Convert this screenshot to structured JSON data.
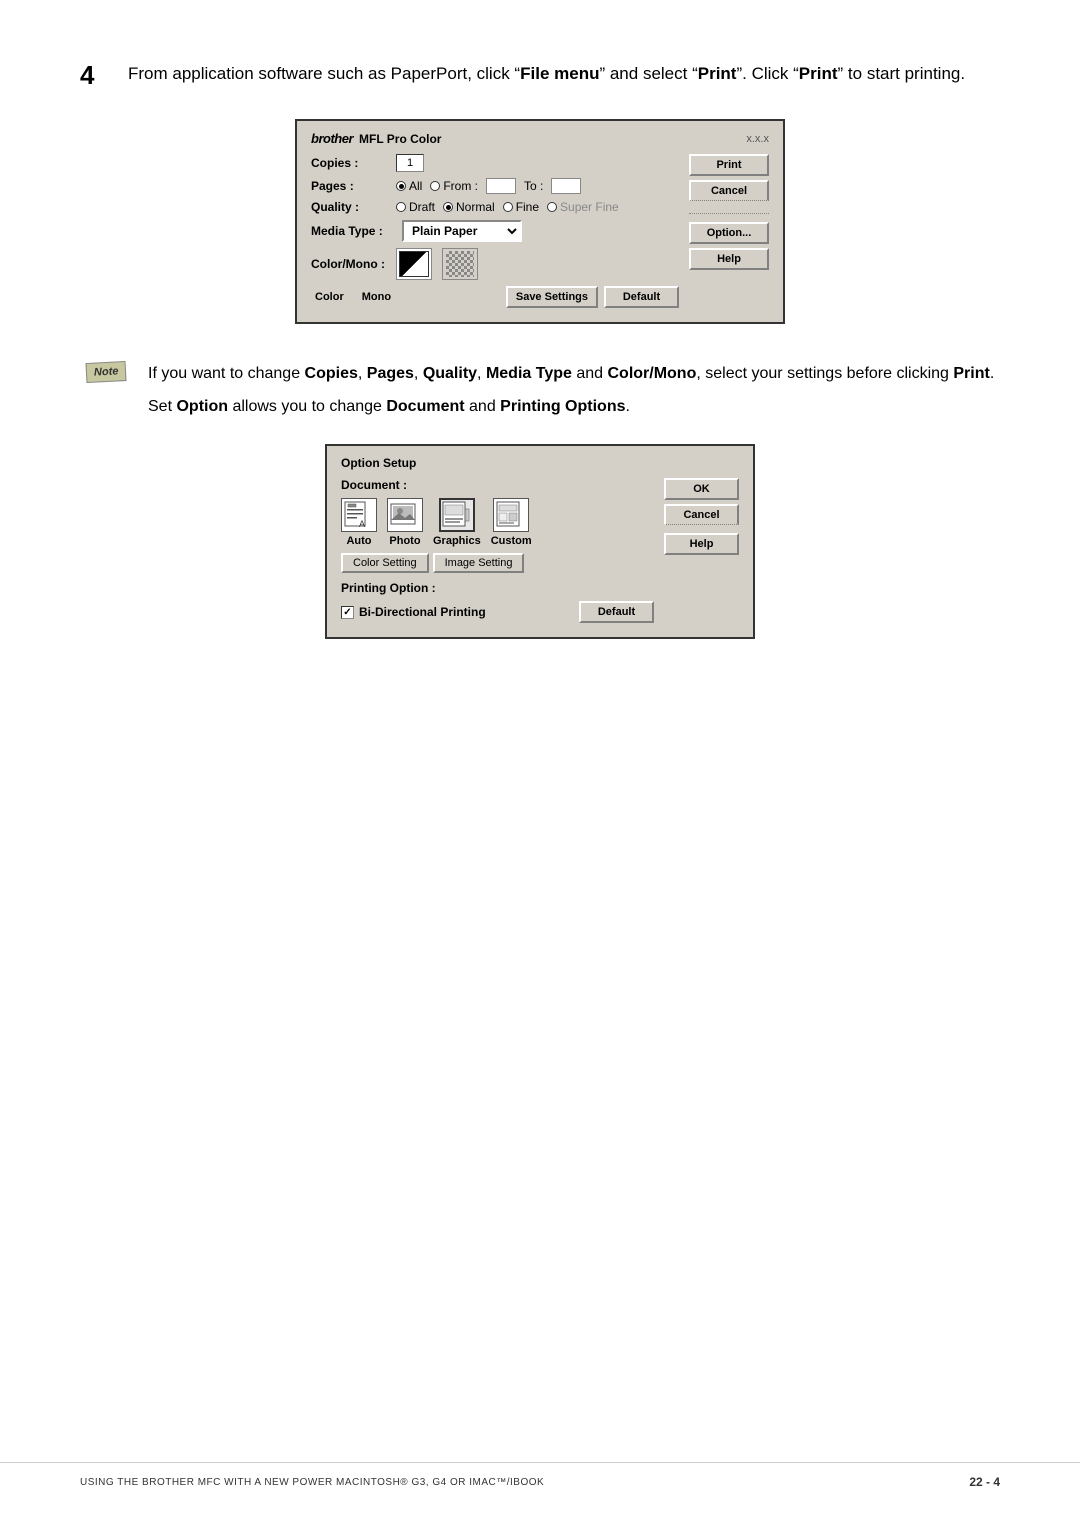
{
  "step": {
    "number": "4",
    "text_parts": [
      "From application software such as PaperPort, click “",
      "File menu",
      "” and select “",
      "Print",
      "”. Click “",
      "Print",
      "” to start printing."
    ]
  },
  "print_dialog": {
    "title": "MFL Pro Color",
    "brand": "brother",
    "version": "x.x.x",
    "copies_label": "Copies :",
    "copies_value": "1",
    "pages_label": "Pages :",
    "pages_all": "All",
    "pages_from": "From :",
    "pages_to": "To :",
    "quality_label": "Quality :",
    "quality_draft": "Draft",
    "quality_normal": "Normal",
    "quality_fine": "Fine",
    "quality_superfine": "Super Fine",
    "media_label": "Media Type :",
    "media_value": "Plain Paper",
    "color_mono_label": "Color/Mono :",
    "color_label": "Color",
    "mono_label": "Mono",
    "buttons": {
      "print": "Print",
      "cancel": "Cancel",
      "option": "Option...",
      "help": "Help",
      "save_settings": "Save Settings",
      "default": "Default"
    }
  },
  "note": {
    "badge": "Note",
    "text_parts": [
      "If you want to change ",
      "Copies",
      ", ",
      "Pages",
      ", ",
      "Quality",
      ", ",
      "Media Type",
      " and ",
      "Color/Mono",
      ",\nselect your settings before clicking ",
      "Print",
      "."
    ],
    "second_line_parts": [
      "Set ",
      "Option",
      " allows you to change ",
      "Document",
      " and ",
      "Printing Options",
      "."
    ]
  },
  "option_dialog": {
    "title": "Option Setup",
    "document_label": "Document :",
    "doc_types": [
      {
        "label": "Auto",
        "selected": false
      },
      {
        "label": "Photo",
        "selected": false
      },
      {
        "label": "Graphics",
        "selected": true
      },
      {
        "label": "Custom",
        "selected": false
      }
    ],
    "color_setting_btn": "Color Setting",
    "image_setting_btn": "Image Setting",
    "printing_option_label": "Printing Option :",
    "bidirectional_label": "Bi-Directional Printing",
    "bidirectional_checked": true,
    "buttons": {
      "ok": "OK",
      "cancel": "Cancel",
      "help": "Help",
      "default": "Default"
    }
  },
  "footer": {
    "text": "USING THE BROTHER MFC WITH A NEW POWER MACINTOSH® G3, G4 OR IMAC™/IBOOK",
    "page": "22 - 4"
  }
}
